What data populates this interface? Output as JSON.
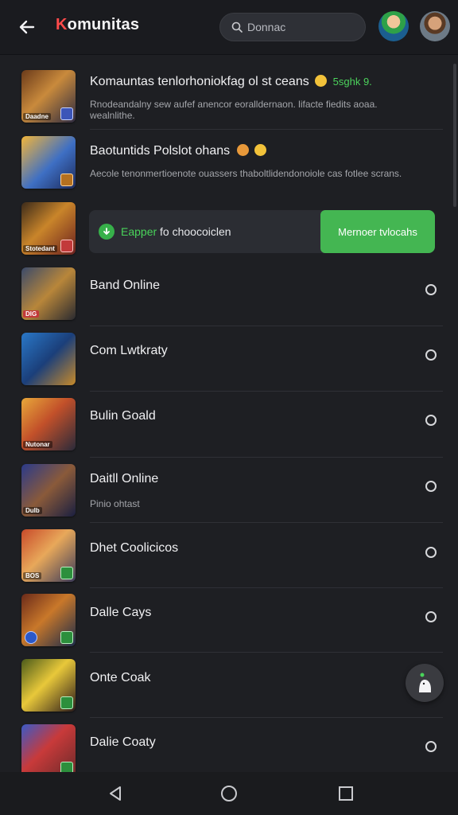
{
  "header": {
    "title_first": "K",
    "title_rest": "omunitas",
    "search_placeholder": "Donnac"
  },
  "rows": [
    {
      "title": "Komauntas tenlorhoniokfag ol st ceans",
      "title_highlight": "5sghk 9.",
      "subtitle": "Rnodeandalny sew aufef anencor eoralldernaon. lifacte fiedits aoaa. wealnlithe.",
      "thumb_tag": "Daadne"
    },
    {
      "title": "Baotuntids Polslot ohans",
      "subtitle": "Aecole tenonmertioenote ouassers thaboltlidendonoiole cas fotlee scrans.",
      "thumb_tag": ""
    },
    {
      "title": "",
      "subtitle": "",
      "thumb_tag": "Stotedant"
    },
    {
      "title": "Band Online",
      "subtitle": "",
      "thumb_tag": "DIG"
    },
    {
      "title": "Com Lwtkraty",
      "subtitle": "",
      "thumb_tag": ""
    },
    {
      "title": "Bulin Goald",
      "subtitle": "",
      "thumb_tag": "Nutonar"
    },
    {
      "title": "Daitll Online",
      "subtitle": "Pinio ohtast",
      "thumb_tag": "DuIb"
    },
    {
      "title": "Dhet Coolicicos",
      "subtitle": "",
      "thumb_tag": "BOS"
    },
    {
      "title": "Dalle Cays",
      "subtitle": "",
      "thumb_tag": ""
    },
    {
      "title": "Onte Coak",
      "subtitle": "",
      "thumb_tag": ""
    },
    {
      "title": "Dalie Coaty",
      "subtitle": "",
      "thumb_tag": ""
    }
  ],
  "promo": {
    "text_green": "Eapper",
    "text_rest": "fo choocoiclen",
    "button_label": "Mernoer tvlocahs"
  },
  "icons": {
    "back": "arrow-left-icon",
    "search": "search-icon",
    "fab": "chat-bot-icon",
    "nav_back": "triangle-back-icon",
    "nav_home": "circle-home-icon",
    "nav_recent": "square-recent-icon"
  },
  "colors": {
    "accent_red": "#ff4a4a",
    "accent_green": "#44b652",
    "background": "#1e1f23"
  }
}
